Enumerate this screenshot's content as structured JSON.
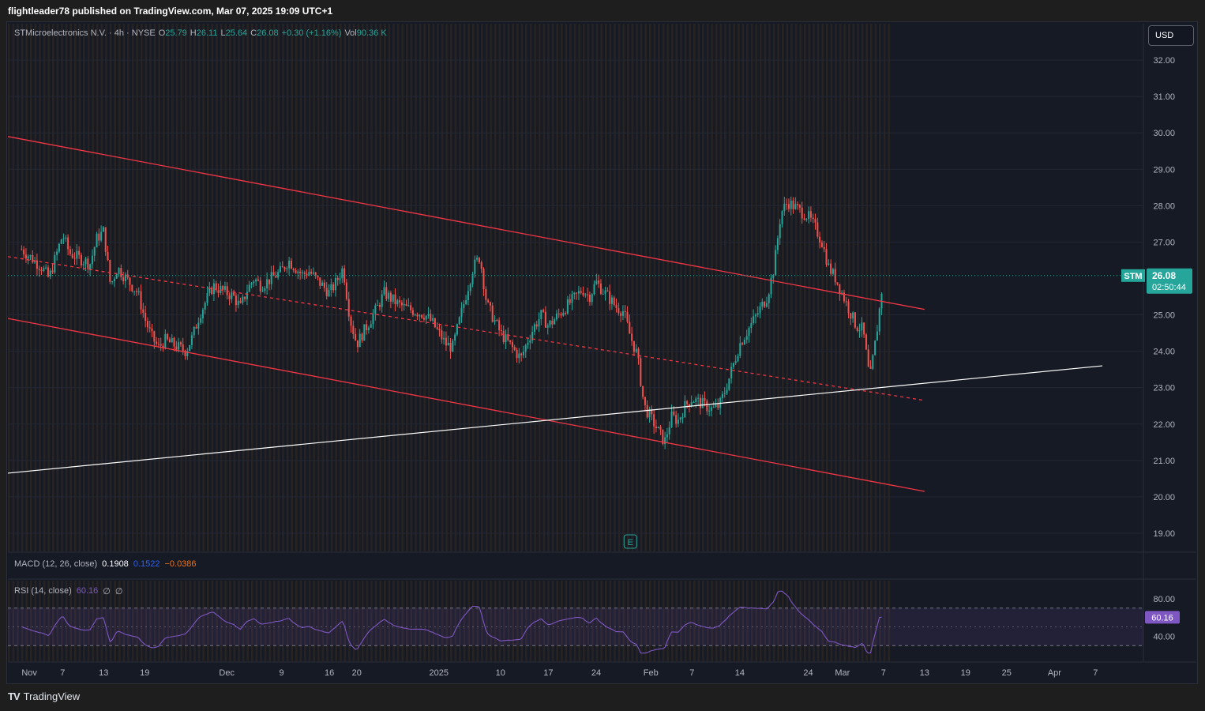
{
  "header": {
    "publisher_line": "flightleader78 published on TradingView.com, Mar 07, 2025 19:09 UTC+1"
  },
  "legend": {
    "symbol_line": "STMicroelectronics N.V. · 4h · NYSE",
    "open_label": "O",
    "open": "25.79",
    "high_label": "H",
    "high": "26.11",
    "low_label": "L",
    "low": "25.64",
    "close_label": "C",
    "close": "26.08",
    "change": "+0.30 (+1.16%)",
    "vol_label": "Vol",
    "vol": "90.36 K"
  },
  "currency_button": "USD",
  "price_tag": {
    "symbol": "STM",
    "price": "26.08",
    "countdown": "02:50:44"
  },
  "macd": {
    "label": "MACD (12, 26, close)",
    "macd": "0.1908",
    "signal": "0.1522",
    "hist": "−0.0386"
  },
  "rsi": {
    "label": "RSI (14, close)",
    "value": "60.16",
    "extra1": "∅",
    "extra2": "∅",
    "current": 60.16
  },
  "earnings_marker": "E",
  "footer": {
    "brand": "TradingView"
  },
  "colors": {
    "up": "#26a69a",
    "down": "#ef5350",
    "channel": "#f23645",
    "trendline": "#ffffff",
    "rsi": "#7e57c2",
    "background": "#161a25"
  },
  "chart_data": {
    "type": "candlestick",
    "symbol": "STM",
    "interval": "4h",
    "ylim": [
      18.5,
      33.0
    ],
    "y_ticks": [
      "32.00",
      "31.00",
      "30.00",
      "29.00",
      "28.00",
      "27.00",
      "25.00",
      "24.00",
      "23.00",
      "22.00",
      "21.00",
      "20.00",
      "19.00"
    ],
    "x_ticks": [
      "Nov",
      "7",
      "13",
      "19",
      "Dec",
      "9",
      "16",
      "20",
      "2025",
      "10",
      "17",
      "24",
      "Feb",
      "7",
      "14",
      "24",
      "Mar",
      "7",
      "13",
      "19",
      "25",
      "Apr",
      "7"
    ],
    "close_path": [
      {
        "date": "2024-11-01",
        "price": 26.8
      },
      {
        "date": "2024-11-04",
        "price": 26.3
      },
      {
        "date": "2024-11-05",
        "price": 26.0
      },
      {
        "date": "2024-11-07",
        "price": 27.2
      },
      {
        "date": "2024-11-08",
        "price": 26.7
      },
      {
        "date": "2024-11-11",
        "price": 26.4
      },
      {
        "date": "2024-11-12",
        "price": 27.1
      },
      {
        "date": "2024-11-13",
        "price": 27.3
      },
      {
        "date": "2024-11-14",
        "price": 25.8
      },
      {
        "date": "2024-11-15",
        "price": 26.3
      },
      {
        "date": "2024-11-18",
        "price": 25.6
      },
      {
        "date": "2024-11-19",
        "price": 24.9
      },
      {
        "date": "2024-11-20",
        "price": 24.4
      },
      {
        "date": "2024-11-21",
        "price": 24.1
      },
      {
        "date": "2024-11-22",
        "price": 24.3
      },
      {
        "date": "2024-11-25",
        "price": 24.0
      },
      {
        "date": "2024-11-26",
        "price": 24.4
      },
      {
        "date": "2024-11-27",
        "price": 25.0
      },
      {
        "date": "2024-11-29",
        "price": 25.8
      },
      {
        "date": "2024-12-02",
        "price": 25.5
      },
      {
        "date": "2024-12-03",
        "price": 25.2
      },
      {
        "date": "2024-12-04",
        "price": 25.7
      },
      {
        "date": "2024-12-05",
        "price": 26.0
      },
      {
        "date": "2024-12-06",
        "price": 25.8
      },
      {
        "date": "2024-12-09",
        "price": 26.2
      },
      {
        "date": "2024-12-10",
        "price": 26.5
      },
      {
        "date": "2024-12-11",
        "price": 26.3
      },
      {
        "date": "2024-12-12",
        "price": 26.1
      },
      {
        "date": "2024-12-13",
        "price": 26.2
      },
      {
        "date": "2024-12-16",
        "price": 25.6
      },
      {
        "date": "2024-12-17",
        "price": 25.9
      },
      {
        "date": "2024-12-18",
        "price": 26.3
      },
      {
        "date": "2024-12-19",
        "price": 24.9
      },
      {
        "date": "2024-12-20",
        "price": 24.2
      },
      {
        "date": "2024-12-23",
        "price": 25.2
      },
      {
        "date": "2024-12-24",
        "price": 25.6
      },
      {
        "date": "2024-12-26",
        "price": 25.3
      },
      {
        "date": "2024-12-27",
        "price": 25.2
      },
      {
        "date": "2024-12-30",
        "price": 25.0
      },
      {
        "date": "2024-12-31",
        "price": 24.8
      },
      {
        "date": "2025-01-02",
        "price": 24.2
      },
      {
        "date": "2025-01-03",
        "price": 24.1
      },
      {
        "date": "2025-01-06",
        "price": 26.3
      },
      {
        "date": "2025-01-07",
        "price": 26.6
      },
      {
        "date": "2025-01-08",
        "price": 25.3
      },
      {
        "date": "2025-01-10",
        "price": 24.5
      },
      {
        "date": "2025-01-13",
        "price": 23.8
      },
      {
        "date": "2025-01-14",
        "price": 24.3
      },
      {
        "date": "2025-01-15",
        "price": 24.7
      },
      {
        "date": "2025-01-16",
        "price": 25.0
      },
      {
        "date": "2025-01-17",
        "price": 24.7
      },
      {
        "date": "2025-01-21",
        "price": 25.5
      },
      {
        "date": "2025-01-22",
        "price": 25.7
      },
      {
        "date": "2025-01-23",
        "price": 25.5
      },
      {
        "date": "2025-01-24",
        "price": 25.9
      },
      {
        "date": "2025-01-27",
        "price": 25.2
      },
      {
        "date": "2025-01-28",
        "price": 25.1
      },
      {
        "date": "2025-01-29",
        "price": 24.4
      },
      {
        "date": "2025-01-30",
        "price": 23.9
      },
      {
        "date": "2025-01-31",
        "price": 22.5
      },
      {
        "date": "2025-02-03",
        "price": 21.5
      },
      {
        "date": "2025-02-04",
        "price": 22.2
      },
      {
        "date": "2025-02-05",
        "price": 22.1
      },
      {
        "date": "2025-02-06",
        "price": 22.5
      },
      {
        "date": "2025-02-07",
        "price": 22.7
      },
      {
        "date": "2025-02-10",
        "price": 22.4
      },
      {
        "date": "2025-02-11",
        "price": 22.5
      },
      {
        "date": "2025-02-12",
        "price": 23.0
      },
      {
        "date": "2025-02-13",
        "price": 23.6
      },
      {
        "date": "2025-02-14",
        "price": 24.2
      },
      {
        "date": "2025-02-18",
        "price": 25.5
      },
      {
        "date": "2025-02-19",
        "price": 26.3
      },
      {
        "date": "2025-02-20",
        "price": 27.8
      },
      {
        "date": "2025-02-21",
        "price": 28.1
      },
      {
        "date": "2025-02-24",
        "price": 27.7
      },
      {
        "date": "2025-02-25",
        "price": 27.4
      },
      {
        "date": "2025-02-26",
        "price": 27.0
      },
      {
        "date": "2025-02-27",
        "price": 26.3
      },
      {
        "date": "2025-02-28",
        "price": 26.0
      },
      {
        "date": "2025-03-03",
        "price": 24.7
      },
      {
        "date": "2025-03-04",
        "price": 24.6
      },
      {
        "date": "2025-03-05",
        "price": 23.2
      },
      {
        "date": "2025-03-06",
        "price": 24.5
      },
      {
        "date": "2025-03-07",
        "price": 26.08
      }
    ],
    "annotations": [
      {
        "type": "channel-upper",
        "from": {
          "date": "2024-10-30",
          "price": 29.9
        },
        "to": {
          "date": "2025-03-13",
          "price": 25.15
        },
        "color": "#f23645"
      },
      {
        "type": "channel-mid-dashed",
        "from": {
          "date": "2024-10-30",
          "price": 26.6
        },
        "to": {
          "date": "2025-03-13",
          "price": 22.65
        },
        "color": "#f23645"
      },
      {
        "type": "channel-lower",
        "from": {
          "date": "2024-10-30",
          "price": 24.9
        },
        "to": {
          "date": "2025-03-13",
          "price": 20.15
        },
        "color": "#f23645"
      },
      {
        "type": "trendline",
        "from": {
          "date": "2024-10-30",
          "price": 20.65
        },
        "to": {
          "date": "2025-04-08",
          "price": 23.6
        },
        "color": "#ffffff"
      }
    ],
    "rsi_ticks": [
      "80.00",
      "40.00"
    ],
    "rsi_levels": [
      70,
      30
    ],
    "rsi_range": [
      15,
      95
    ]
  }
}
